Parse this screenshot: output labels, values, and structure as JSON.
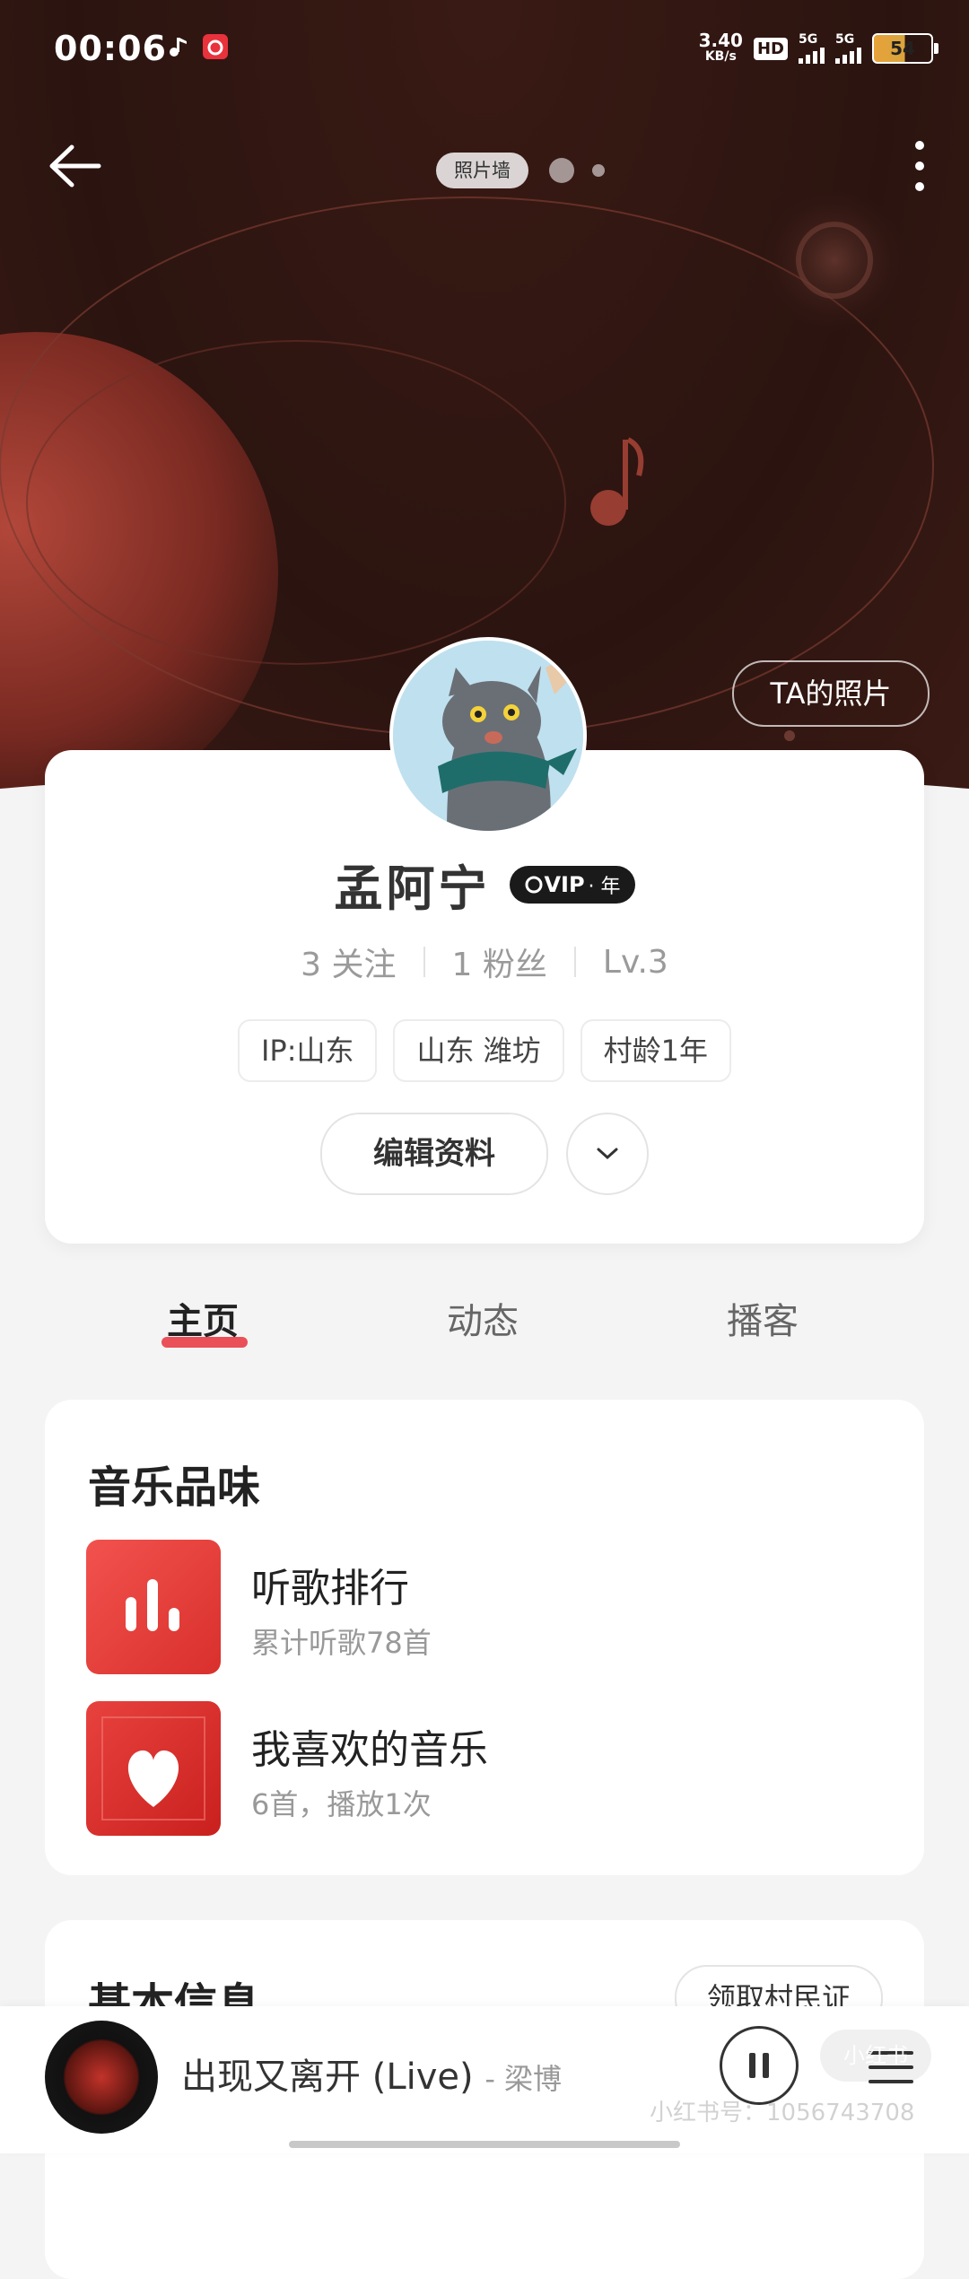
{
  "status_bar": {
    "time": "00:06",
    "net_speed_value": "3.40",
    "net_speed_unit": "KB/s",
    "hd_label": "HD",
    "sim1_label": "5G",
    "sim2_label": "5G",
    "battery_level": "54"
  },
  "header": {
    "photo_wall_label": "照片墙",
    "ta_photos_label": "TA的照片"
  },
  "profile": {
    "name": "孟阿宁",
    "vip_label": "VIP",
    "vip_sub": "· 年",
    "following": "3 关注",
    "followers": "1 粉丝",
    "level": "Lv.3",
    "tags": [
      "IP:山东",
      "山东 潍坊",
      "村龄1年"
    ],
    "edit_label": "编辑资料"
  },
  "tabs": [
    {
      "label": "主页",
      "active": true
    },
    {
      "label": "动态",
      "active": false
    },
    {
      "label": "播客",
      "active": false
    }
  ],
  "music_taste": {
    "title": "音乐品味",
    "items": [
      {
        "title": "听歌排行",
        "subtitle": "累计听歌78首",
        "icon": "bar-chart-icon"
      },
      {
        "title": "我喜欢的音乐",
        "subtitle": "6首，播放1次",
        "icon": "heart-icon"
      }
    ]
  },
  "basic_info": {
    "title": "基本信息",
    "village_button": "领取村民证"
  },
  "player": {
    "song": "出现又离开 (Live)",
    "artist": "- 梁博"
  },
  "watermark": {
    "text": "小红书号：1056743708",
    "logo": "小红书"
  },
  "colors": {
    "accent": "#e8323c",
    "hero_bg": "#2b1410"
  }
}
